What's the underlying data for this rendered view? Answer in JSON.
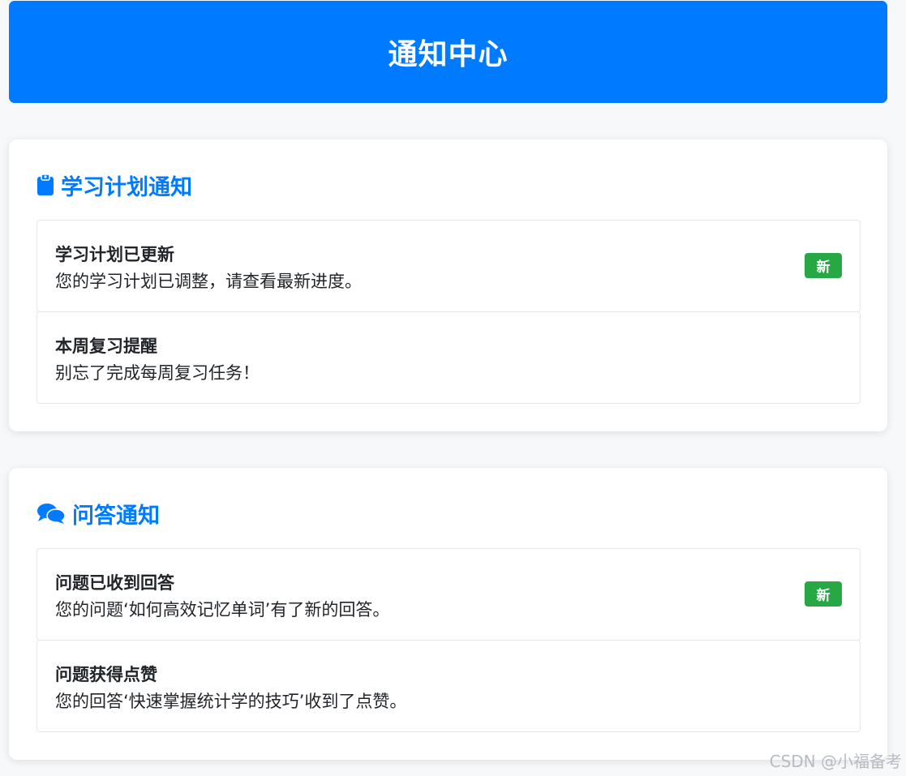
{
  "header": {
    "title": "通知中心"
  },
  "sections": [
    {
      "title": "学习计划通知",
      "icon": "clipboard-icon",
      "items": [
        {
          "title": "学习计划已更新",
          "text": "您的学习计划已调整，请查看最新进度。",
          "badge": "新"
        },
        {
          "title": "本周复习提醒",
          "text": "别忘了完成每周复习任务！"
        }
      ]
    },
    {
      "title": "问答通知",
      "icon": "comments-icon",
      "items": [
        {
          "title": "问题已收到回答",
          "text": "您的问题‘如何高效记忆单词’有了新的回答。",
          "badge": "新"
        },
        {
          "title": "问题获得点赞",
          "text": "您的回答‘快速掌握统计学的技巧’收到了点赞。"
        }
      ]
    }
  ],
  "watermark": "CSDN @小福备考",
  "colors": {
    "primary": "#007bff",
    "badge": "#28a745",
    "background": "#f6f8fa"
  }
}
